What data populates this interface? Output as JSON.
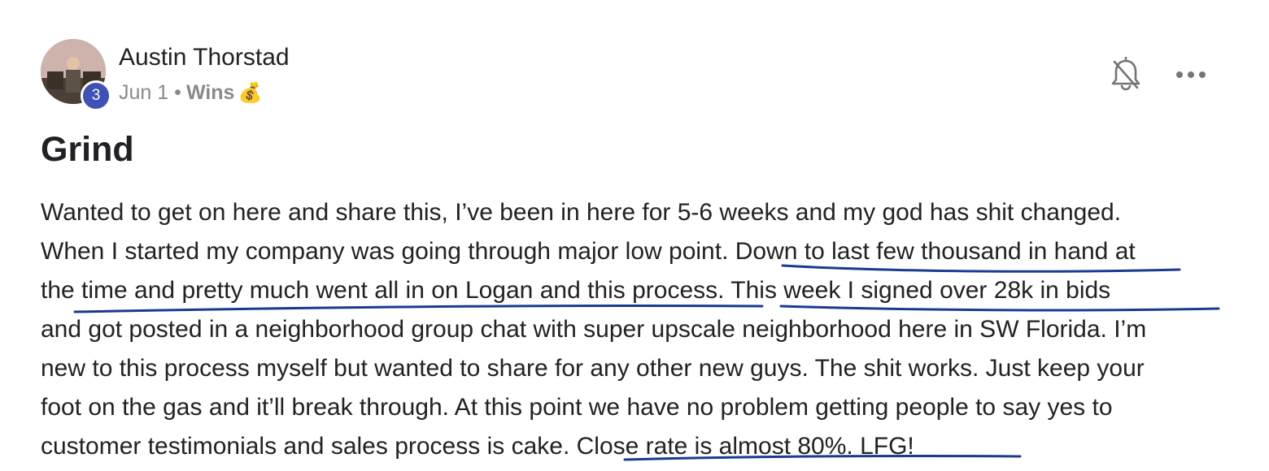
{
  "post": {
    "author": "Austin Thorstad",
    "level": "3",
    "date": "Jun 1",
    "separator": "•",
    "category": "Wins",
    "category_emoji": "💰",
    "title": "Grind",
    "lines": [
      "Wanted to get on here and share this, I’ve been in here for 5-6 weeks and my god has shit changed.",
      "When I started my company was going through major low point. Down to last few thousand in hand at",
      "the time and pretty much went all in on Logan and this process. This week I signed over 28k in bids",
      "and got posted in a neighborhood group chat with super upscale neighborhood here in SW Florida. I’m",
      "new to this process myself but wanted to share for any other new guys. The shit works. Just keep your",
      "foot on the gas and it’ll break through. At this point we have no problem getting people to say yes to",
      "customer testimonials and sales process is cake. Close rate is almost 80%. LFG!"
    ]
  },
  "icons": {
    "notifications": "bell-off-icon",
    "more": "more-horizontal-icon"
  },
  "colors": {
    "level_badge": "#3f51b5",
    "underline_ink": "#1a3a8f"
  }
}
